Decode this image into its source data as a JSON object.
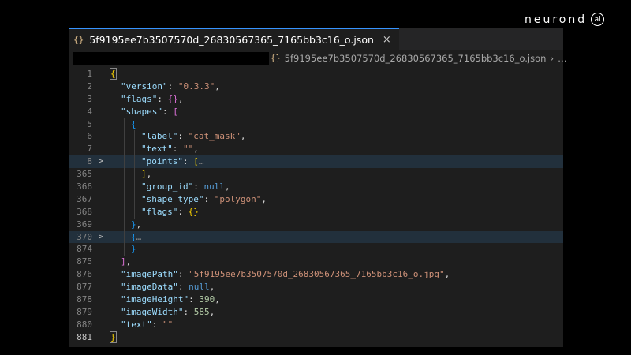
{
  "brand": {
    "text": "neurond",
    "ai": "ai"
  },
  "tab": {
    "icon": "{}",
    "filename": "5f9195ee7b3507570d_26830567365_7165bb3c16_o.json",
    "close": "×"
  },
  "breadcrumb": {
    "icon": "{}",
    "filename": "5f9195ee7b3507570d_26830567365_7165bb3c16_o.json",
    "sep": "›",
    "more": "…"
  },
  "lines": [
    {
      "num": "1",
      "active": false,
      "fold": "",
      "highlight": false,
      "indent": 0,
      "tokens": [
        {
          "t": "{",
          "c": "b1 bm"
        }
      ]
    },
    {
      "num": "2",
      "fold": "",
      "indent": 1,
      "tokens": [
        {
          "t": "\"version\"",
          "c": "k"
        },
        {
          "t": ": ",
          "c": "p"
        },
        {
          "t": "\"0.3.3\"",
          "c": "s"
        },
        {
          "t": ",",
          "c": "p"
        }
      ]
    },
    {
      "num": "3",
      "fold": "",
      "indent": 1,
      "tokens": [
        {
          "t": "\"flags\"",
          "c": "k"
        },
        {
          "t": ": ",
          "c": "p"
        },
        {
          "t": "{}",
          "c": "b2"
        },
        {
          "t": ",",
          "c": "p"
        }
      ]
    },
    {
      "num": "4",
      "fold": "",
      "indent": 1,
      "tokens": [
        {
          "t": "\"shapes\"",
          "c": "k"
        },
        {
          "t": ": ",
          "c": "p"
        },
        {
          "t": "[",
          "c": "b2"
        }
      ]
    },
    {
      "num": "5",
      "fold": "",
      "indent": 2,
      "tokens": [
        {
          "t": "{",
          "c": "b3"
        }
      ]
    },
    {
      "num": "6",
      "fold": "",
      "indent": 3,
      "tokens": [
        {
          "t": "\"label\"",
          "c": "k"
        },
        {
          "t": ": ",
          "c": "p"
        },
        {
          "t": "\"cat_mask\"",
          "c": "s"
        },
        {
          "t": ",",
          "c": "p"
        }
      ]
    },
    {
      "num": "7",
      "fold": "",
      "indent": 3,
      "tokens": [
        {
          "t": "\"text\"",
          "c": "k"
        },
        {
          "t": ": ",
          "c": "p"
        },
        {
          "t": "\"\"",
          "c": "s"
        },
        {
          "t": ",",
          "c": "p"
        }
      ]
    },
    {
      "num": "8",
      "fold": ">",
      "highlight": true,
      "indent": 3,
      "tokens": [
        {
          "t": "\"points\"",
          "c": "k"
        },
        {
          "t": ": ",
          "c": "p"
        },
        {
          "t": "[",
          "c": "b1"
        },
        {
          "t": "…",
          "c": "ell"
        }
      ]
    },
    {
      "num": "365",
      "fold": "",
      "indent": 3,
      "tokens": [
        {
          "t": "]",
          "c": "b1"
        },
        {
          "t": ",",
          "c": "p"
        }
      ]
    },
    {
      "num": "366",
      "fold": "",
      "indent": 3,
      "tokens": [
        {
          "t": "\"group_id\"",
          "c": "k"
        },
        {
          "t": ": ",
          "c": "p"
        },
        {
          "t": "null",
          "c": "kw"
        },
        {
          "t": ",",
          "c": "p"
        }
      ]
    },
    {
      "num": "367",
      "fold": "",
      "indent": 3,
      "tokens": [
        {
          "t": "\"shape_type\"",
          "c": "k"
        },
        {
          "t": ": ",
          "c": "p"
        },
        {
          "t": "\"polygon\"",
          "c": "s"
        },
        {
          "t": ",",
          "c": "p"
        }
      ]
    },
    {
      "num": "368",
      "fold": "",
      "indent": 3,
      "tokens": [
        {
          "t": "\"flags\"",
          "c": "k"
        },
        {
          "t": ": ",
          "c": "p"
        },
        {
          "t": "{}",
          "c": "b1"
        }
      ]
    },
    {
      "num": "369",
      "fold": "",
      "indent": 2,
      "tokens": [
        {
          "t": "}",
          "c": "b3"
        },
        {
          "t": ",",
          "c": "p"
        }
      ]
    },
    {
      "num": "370",
      "fold": ">",
      "highlight": true,
      "indent": 2,
      "tokens": [
        {
          "t": "{",
          "c": "b3"
        },
        {
          "t": "…",
          "c": "ell"
        }
      ]
    },
    {
      "num": "874",
      "fold": "",
      "indent": 2,
      "tokens": [
        {
          "t": "}",
          "c": "b3"
        }
      ]
    },
    {
      "num": "875",
      "fold": "",
      "indent": 1,
      "tokens": [
        {
          "t": "]",
          "c": "b2"
        },
        {
          "t": ",",
          "c": "p"
        }
      ]
    },
    {
      "num": "876",
      "fold": "",
      "indent": 1,
      "tokens": [
        {
          "t": "\"imagePath\"",
          "c": "k"
        },
        {
          "t": ": ",
          "c": "p"
        },
        {
          "t": "\"5f9195ee7b3507570d_26830567365_7165bb3c16_o.jpg\"",
          "c": "s"
        },
        {
          "t": ",",
          "c": "p"
        }
      ]
    },
    {
      "num": "877",
      "fold": "",
      "indent": 1,
      "tokens": [
        {
          "t": "\"imageData\"",
          "c": "k"
        },
        {
          "t": ": ",
          "c": "p"
        },
        {
          "t": "null",
          "c": "kw"
        },
        {
          "t": ",",
          "c": "p"
        }
      ]
    },
    {
      "num": "878",
      "fold": "",
      "indent": 1,
      "tokens": [
        {
          "t": "\"imageHeight\"",
          "c": "k"
        },
        {
          "t": ": ",
          "c": "p"
        },
        {
          "t": "390",
          "c": "n"
        },
        {
          "t": ",",
          "c": "p"
        }
      ]
    },
    {
      "num": "879",
      "fold": "",
      "indent": 1,
      "tokens": [
        {
          "t": "\"imageWidth\"",
          "c": "k"
        },
        {
          "t": ": ",
          "c": "p"
        },
        {
          "t": "585",
          "c": "n"
        },
        {
          "t": ",",
          "c": "p"
        }
      ]
    },
    {
      "num": "880",
      "fold": "",
      "indent": 1,
      "tokens": [
        {
          "t": "\"text\"",
          "c": "k"
        },
        {
          "t": ": ",
          "c": "p"
        },
        {
          "t": "\"\"",
          "c": "s"
        }
      ]
    },
    {
      "num": "881",
      "active": true,
      "fold": "",
      "indent": 0,
      "tokens": [
        {
          "t": "}",
          "c": "b1 bm"
        }
      ]
    }
  ]
}
